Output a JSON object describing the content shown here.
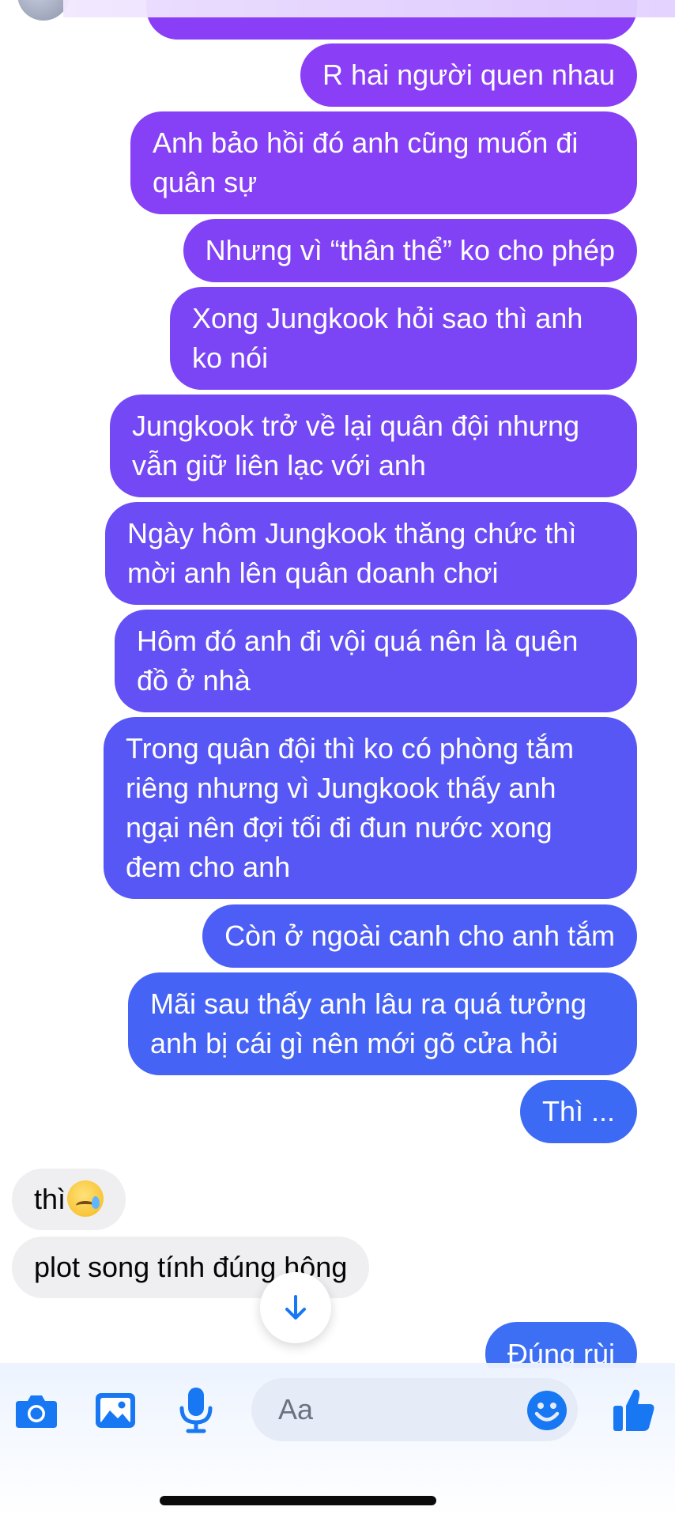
{
  "outgoing_messages": [
    "R hai người quen nhau",
    [
      "Anh bảo hồi đó anh cũng muốn đi",
      "quân sự"
    ],
    "Nhưng vì “thân thể” ko cho phép",
    [
      "Xong Jungkook hỏi sao thì anh",
      "ko nói"
    ],
    [
      "Jungkook trở về lại quân đội nhưng",
      "vẫn giữ liên lạc với anh"
    ],
    [
      "Ngày hôm Jungkook thăng chức thì",
      "mời anh lên quân doanh chơi"
    ],
    [
      "Hôm đó anh đi vội quá nên là quên",
      "đồ ở nhà"
    ],
    [
      "Trong quân đội thì ko có phòng tắm",
      "riêng nhưng vì Jungkook thấy anh",
      "ngại nên đợi tối đi đun nước xong",
      "đem cho anh"
    ],
    "Còn ở ngoài canh cho anh tắm",
    [
      "Mãi sau thấy anh lâu ra quá tưởng",
      "anh bị cái gì nên mới gõ cửa hỏi"
    ],
    "Thì ..."
  ],
  "incoming_messages": [
    {
      "text": "thì",
      "emoji": "crying-face"
    },
    {
      "text": "plot song tính đúng hông"
    }
  ],
  "last_outgoing_partial": "Đúng rùi",
  "composer": {
    "placeholder": "Aa",
    "icons": [
      "camera-icon",
      "image-icon",
      "microphone-icon",
      "emoji-icon",
      "thumbs-up-icon"
    ]
  },
  "colors": {
    "bubble_gradient_top": "#8a3ef5",
    "bubble_gradient_bottom": "#3d6cf4",
    "accent_blue": "#1877f2",
    "incoming_bubble": "#efeff1"
  }
}
